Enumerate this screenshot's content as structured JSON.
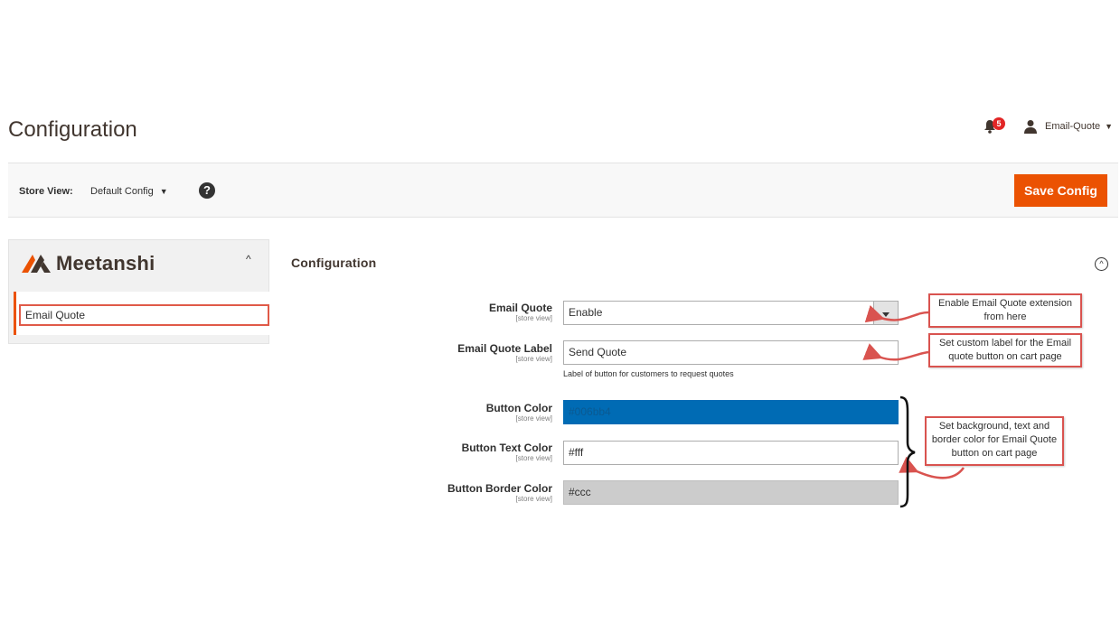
{
  "header": {
    "page_title": "Configuration",
    "notification_count": "5",
    "user_name": "Email-Quote"
  },
  "store_bar": {
    "label": "Store View:",
    "selected": "Default Config",
    "help_glyph": "?",
    "save_label": "Save Config"
  },
  "sidebar": {
    "brand_name": "Meetanshi",
    "items": [
      {
        "label": "Email Quote"
      }
    ]
  },
  "section": {
    "title": "Configuration",
    "fields": [
      {
        "label": "Email Quote",
        "scope": "[store view]",
        "value": "Enable"
      },
      {
        "label": "Email Quote Label",
        "scope": "[store view]",
        "value": "Send Quote",
        "note": "Label of button for customers to request quotes"
      },
      {
        "label": "Button Color",
        "scope": "[store view]",
        "value": "#006bb4"
      },
      {
        "label": "Button Text Color",
        "scope": "[store view]",
        "value": "#fff"
      },
      {
        "label": "Button Border Color",
        "scope": "[store view]",
        "value": "#ccc"
      }
    ]
  },
  "annotations": {
    "enable": "Enable Email Quote extension from here",
    "label": "Set custom label for the Email quote button on cart page",
    "colors": "Set background, text and border color for Email Quote button on cart page"
  },
  "colors": {
    "accent": "#eb5202",
    "button_color_field": "#006bb4",
    "border_color_field": "#cccccc",
    "annotation_red": "#d9534f"
  },
  "icons": {
    "notification": "bell-icon",
    "user": "user-icon",
    "help": "help-icon",
    "collapse": "chevron-up-icon",
    "section_toggle": "circle-chevron-up-icon"
  }
}
